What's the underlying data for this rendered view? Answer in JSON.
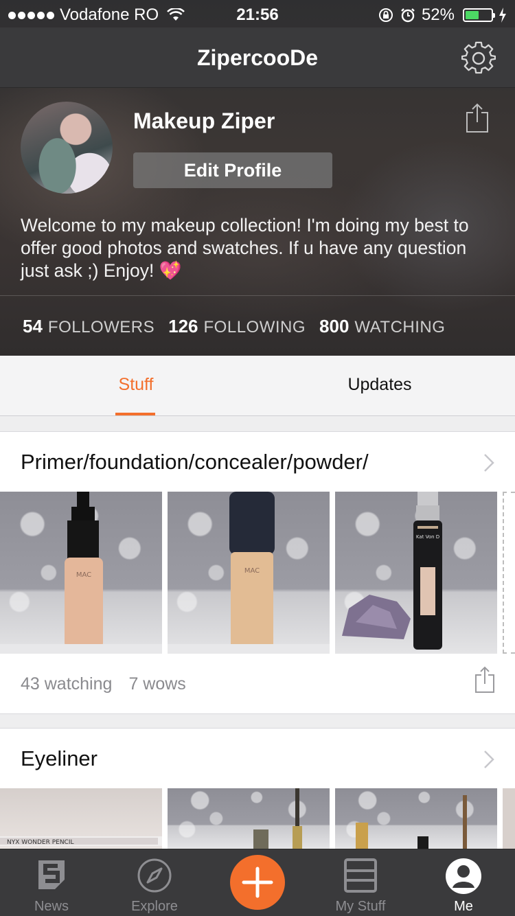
{
  "status_bar": {
    "carrier": "Vodafone RO",
    "time": "21:56",
    "battery_percent": "52%",
    "battery_level": 0.52
  },
  "nav": {
    "title": "ZipercooDe",
    "settings_icon": "gear-icon"
  },
  "profile": {
    "name": "Makeup Ziper",
    "edit_label": "Edit Profile",
    "bio": "Welcome to my makeup collection! I'm doing my best to offer good photos and swatches. If u have any question just ask ;) Enjoy!",
    "bio_emoji": "💖",
    "stats": {
      "followers_count": "54",
      "followers_label": "FOLLOWERS",
      "following_count": "126",
      "following_label": "FOLLOWING",
      "watching_count": "800",
      "watching_label": "WATCHING"
    }
  },
  "tabs": {
    "stuff": "Stuff",
    "updates": "Updates",
    "active": "Stuff"
  },
  "collections": [
    {
      "title": "Primer/foundation/concealer/powder/",
      "watching": "43 watching",
      "wows": "7 wows",
      "photo_labels": [
        "MAC",
        "MAC",
        "Kat Von D"
      ]
    },
    {
      "title": "Eyeliner",
      "photo_labels": [
        "NYX WONDER PENCIL"
      ]
    }
  ],
  "tabbar": {
    "news": "News",
    "explore": "Explore",
    "mystuff": "My Stuff",
    "me": "Me",
    "active": "Me"
  },
  "colors": {
    "accent": "#f36f2c",
    "header_bg": "#3a3a3c",
    "battery_green": "#4cd964"
  }
}
